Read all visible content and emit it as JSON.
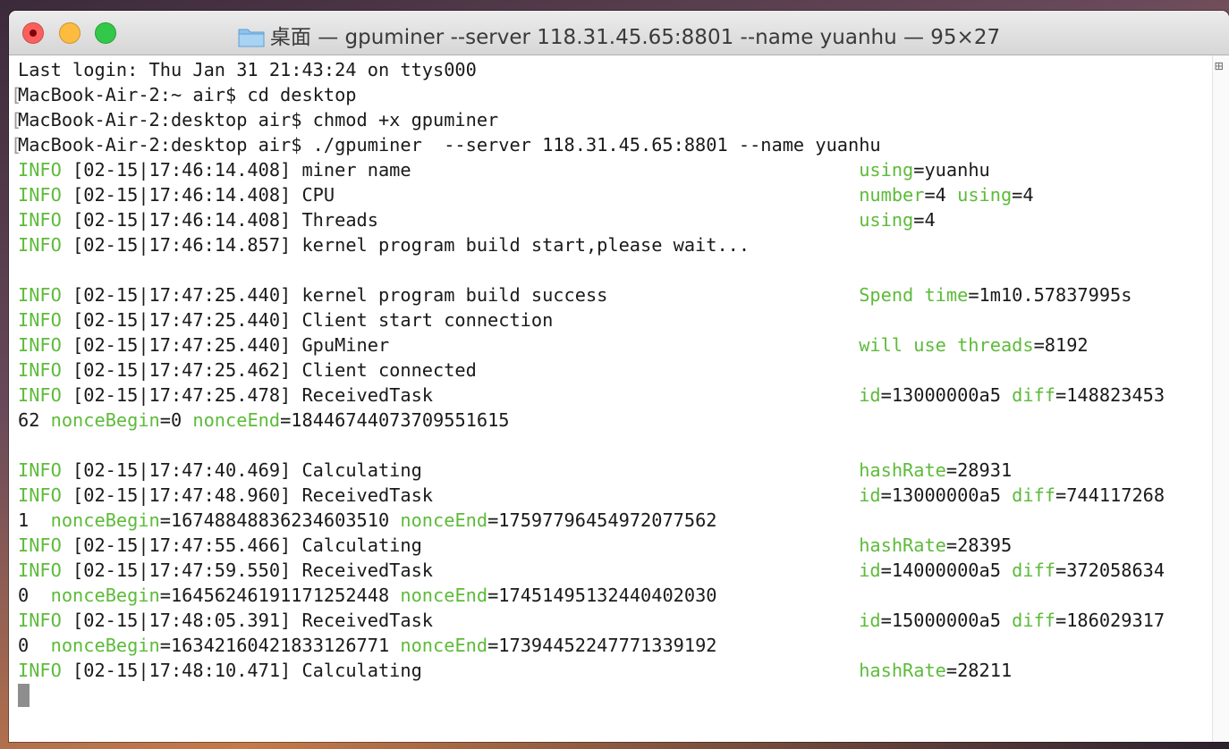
{
  "window": {
    "title_prefix": "桌面",
    "title_rest": " — gpuminer --server 118.31.45.65:8801 --name yuanhu — 95×27"
  },
  "scroll_glyph": "⊞",
  "lines": [
    {
      "plain": "Last login: Thu Jan 31 21:43:24 on ttys000"
    },
    {
      "prompt": "MacBook-Air-2:~ air$ cd desktop"
    },
    {
      "prompt": "MacBook-Air-2:desktop air$ chmod +x gpuminer"
    },
    {
      "prompt": "MacBook-Air-2:desktop air$ ./gpuminer  --server 118.31.45.65:8801 --name yuanhu"
    },
    {
      "tag": "INFO",
      "msg": " [02-15|17:46:14.408] miner name                                         ",
      "kv": [
        [
          "using",
          "=yuanhu"
        ]
      ]
    },
    {
      "tag": "INFO",
      "msg": " [02-15|17:46:14.408] CPU                                                ",
      "kv": [
        [
          "number",
          "=4 "
        ],
        [
          "using",
          "=4"
        ]
      ]
    },
    {
      "tag": "INFO",
      "msg": " [02-15|17:46:14.408] Threads                                            ",
      "kv": [
        [
          "using",
          "=4"
        ]
      ]
    },
    {
      "tag": "INFO",
      "msg": " [02-15|17:46:14.857] kernel program build start,please wait..."
    },
    {
      "plain": ""
    },
    {
      "tag": "INFO",
      "msg": " [02-15|17:47:25.440] kernel program build success                       ",
      "kv": [
        [
          "Spend time",
          "=1m10.57837995s"
        ]
      ]
    },
    {
      "tag": "INFO",
      "msg": " [02-15|17:47:25.440] Client start connection"
    },
    {
      "tag": "INFO",
      "msg": " [02-15|17:47:25.440] GpuMiner                                           ",
      "kv": [
        [
          "will use threads",
          "=8192"
        ]
      ]
    },
    {
      "tag": "INFO",
      "msg": " [02-15|17:47:25.462] Client connected"
    },
    {
      "tag": "INFO",
      "msg": " [02-15|17:47:25.478] ReceivedTask                                       ",
      "kv": [
        [
          "id",
          "=13000000a5 "
        ],
        [
          "diff",
          "=148823453"
        ]
      ]
    },
    {
      "pre": "62 ",
      "kv": [
        [
          "nonceBegin",
          "=0 "
        ],
        [
          "nonceEnd",
          "=18446744073709551615"
        ]
      ]
    },
    {
      "plain": ""
    },
    {
      "tag": "INFO",
      "msg": " [02-15|17:47:40.469] Calculating                                        ",
      "kv": [
        [
          "hashRate",
          "=28931"
        ]
      ]
    },
    {
      "tag": "INFO",
      "msg": " [02-15|17:47:48.960] ReceivedTask                                       ",
      "kv": [
        [
          "id",
          "=13000000a5 "
        ],
        [
          "diff",
          "=744117268"
        ]
      ]
    },
    {
      "pre": "1  ",
      "kv": [
        [
          "nonceBegin",
          "=16748848836234603510 "
        ],
        [
          "nonceEnd",
          "=17597796454972077562"
        ]
      ]
    },
    {
      "tag": "INFO",
      "msg": " [02-15|17:47:55.466] Calculating                                        ",
      "kv": [
        [
          "hashRate",
          "=28395"
        ]
      ]
    },
    {
      "tag": "INFO",
      "msg": " [02-15|17:47:59.550] ReceivedTask                                       ",
      "kv": [
        [
          "id",
          "=14000000a5 "
        ],
        [
          "diff",
          "=372058634"
        ]
      ]
    },
    {
      "pre": "0  ",
      "kv": [
        [
          "nonceBegin",
          "=16456246191171252448 "
        ],
        [
          "nonceEnd",
          "=17451495132440402030"
        ]
      ]
    },
    {
      "tag": "INFO",
      "msg": " [02-15|17:48:05.391] ReceivedTask                                       ",
      "kv": [
        [
          "id",
          "=15000000a5 "
        ],
        [
          "diff",
          "=186029317"
        ]
      ]
    },
    {
      "pre": "0  ",
      "kv": [
        [
          "nonceBegin",
          "=16342160421833126771 "
        ],
        [
          "nonceEnd",
          "=17394452247771339192"
        ]
      ]
    },
    {
      "tag": "INFO",
      "msg": " [02-15|17:48:10.471] Calculating                                        ",
      "kv": [
        [
          "hashRate",
          "=28211"
        ]
      ]
    }
  ]
}
